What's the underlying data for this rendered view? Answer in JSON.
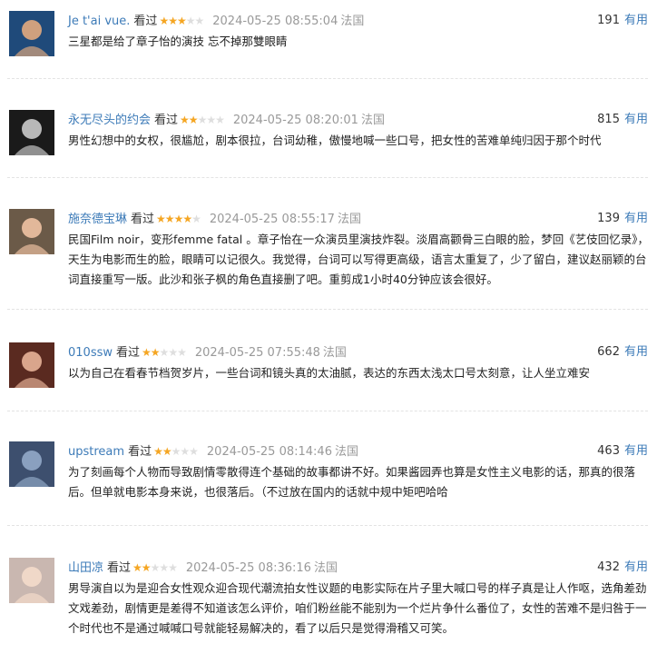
{
  "reviews": [
    {
      "author": "Je t'ai vue.",
      "status": "看过",
      "rating": 3,
      "time": "2024-05-25 08:55:04",
      "location": "法国",
      "votes": "191",
      "useful_label": "有用",
      "content": "三星都是给了章子怡的演技 忘不掉那雙眼睛",
      "avatar_icon": "user-avatar-icon",
      "avatar_colors": [
        "#1f4a7a",
        "#cfa07e"
      ]
    },
    {
      "author": "永无尽头的约会",
      "status": "看过",
      "rating": 2,
      "time": "2024-05-25 08:20:01",
      "location": "法国",
      "votes": "815",
      "useful_label": "有用",
      "content": "男性幻想中的女权，很尴尬，剧本很拉，台词幼稚，傲慢地喊一些口号，把女性的苦难单纯归因于那个时代",
      "avatar_icon": "user-avatar-icon",
      "avatar_colors": [
        "#1a1a1a",
        "#b8b8b8"
      ]
    },
    {
      "author": "施奈德宝琳",
      "status": "看过",
      "rating": 4,
      "time": "2024-05-25 08:55:17",
      "location": "法国",
      "votes": "139",
      "useful_label": "有用",
      "content": "民国Film noir，变形femme fatal 。章子怡在一众演员里演技炸裂。淡眉高颧骨三白眼的脸，梦回《艺伎回忆录》，天生为电影而生的脸，眼睛可以记很久。我觉得，台词可以写得更高级，语言太重复了，少了留白，建议赵丽颖的台词直接重写一版。此沙和张子枫的角色直接删了吧。重剪成1小时40分钟应该会很好。",
      "avatar_icon": "user-avatar-icon",
      "avatar_colors": [
        "#6b5a48",
        "#e2b89a"
      ]
    },
    {
      "author": "010ssw",
      "status": "看过",
      "rating": 2,
      "time": "2024-05-25 07:55:48",
      "location": "法国",
      "votes": "662",
      "useful_label": "有用",
      "content": "以为自己在看春节档贺岁片，一些台词和镜头真的太油腻，表达的东西太浅太口号太刻意，让人坐立难安",
      "avatar_icon": "user-avatar-icon",
      "avatar_colors": [
        "#5a2a20",
        "#d9a58c"
      ]
    },
    {
      "author": "upstream",
      "status": "看过",
      "rating": 2,
      "time": "2024-05-25 08:14:46",
      "location": "法国",
      "votes": "463",
      "useful_label": "有用",
      "content": "为了刻画每个人物而导致剧情零散得连个基础的故事都讲不好。如果酱园弄也算是女性主义电影的话，那真的很落后。但单就电影本身来说，也很落后。（不过放在国内的话就中规中矩吧哈哈",
      "avatar_icon": "user-avatar-icon",
      "avatar_colors": [
        "#3d4f6e",
        "#8aa0bf"
      ]
    },
    {
      "author": "山田凉",
      "status": "看过",
      "rating": 2,
      "time": "2024-05-25 08:36:16",
      "location": "法国",
      "votes": "432",
      "useful_label": "有用",
      "content": "男导演自以为是迎合女性观众迎合现代潮流拍女性议题的电影实际在片子里大喊口号的样子真是让人作呕，选角差劲文戏差劲，剧情更是差得不知道该怎么评价，咱们粉丝能不能别为一个烂片争什么番位了，女性的苦难不是归咎于一个时代也不是通过喊喊口号就能轻易解决的，看了以后只是觉得滑稽又可笑。",
      "avatar_icon": "user-avatar-icon",
      "avatar_colors": [
        "#c9b7b0",
        "#f0d8c8"
      ]
    }
  ],
  "max_rating": 5
}
